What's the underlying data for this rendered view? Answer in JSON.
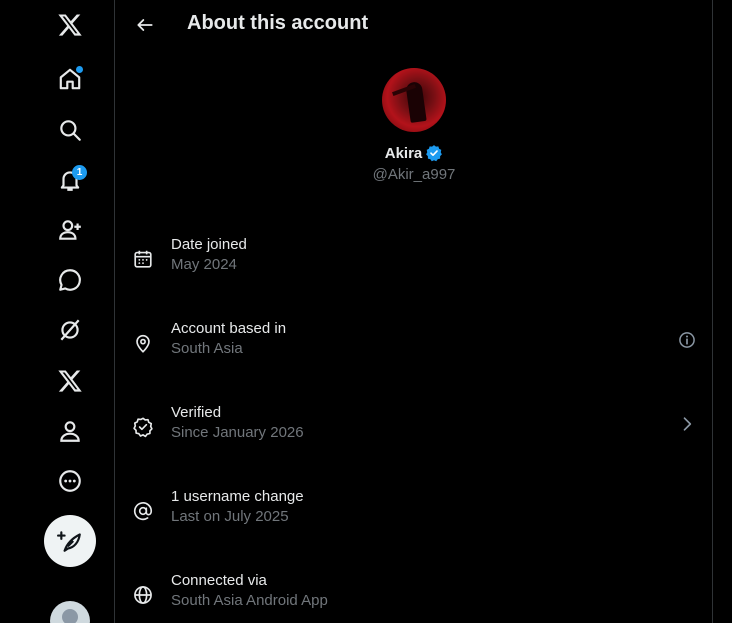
{
  "header": {
    "title": "About this account"
  },
  "sidebar": {
    "items": [
      {
        "icon": "x-logo-icon"
      },
      {
        "icon": "home-icon",
        "has_dot": true
      },
      {
        "icon": "search-icon"
      },
      {
        "icon": "notifications-icon",
        "badge": "1"
      },
      {
        "icon": "follow-icon"
      },
      {
        "icon": "chat-icon"
      },
      {
        "icon": "grok-icon"
      },
      {
        "icon": "premium-x-icon"
      },
      {
        "icon": "profile-icon"
      },
      {
        "icon": "more-icon"
      }
    ],
    "compose_icon": "compose-icon"
  },
  "profile": {
    "name": "Akira",
    "handle": "@Akir_a997",
    "verified": true
  },
  "details": [
    {
      "icon": "calendar-icon",
      "title": "Date joined",
      "subtitle": "May 2024",
      "action": null
    },
    {
      "icon": "location-pin-icon",
      "title": "Account based in",
      "subtitle": "South Asia",
      "action": "info-icon"
    },
    {
      "icon": "verified-outline-icon",
      "title": "Verified",
      "subtitle": "Since January 2026",
      "action": "chevron-right-icon"
    },
    {
      "icon": "at-sign-icon",
      "title": "1 username change",
      "subtitle": "Last on July 2025",
      "action": null
    },
    {
      "icon": "globe-icon",
      "title": "Connected via",
      "subtitle": "South Asia Android App",
      "action": null
    }
  ],
  "colors": {
    "background": "#000000",
    "text_primary": "#e7e9ea",
    "text_secondary": "#71767b",
    "accent": "#1d9bf0",
    "border": "#2f3336"
  }
}
